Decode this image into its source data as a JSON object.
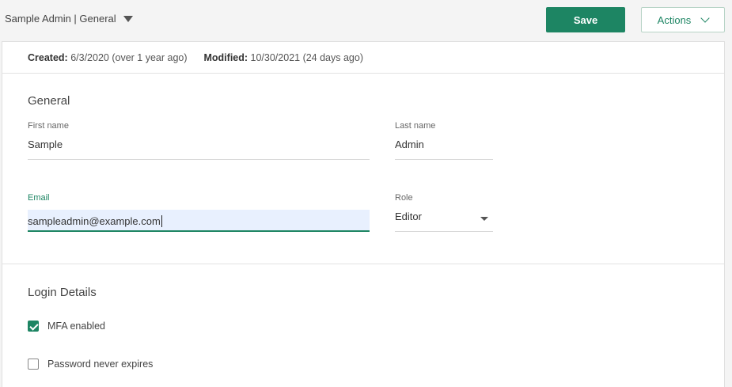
{
  "header": {
    "breadcrumb": "Sample Admin | General",
    "save_label": "Save",
    "actions_label": "Actions"
  },
  "meta": {
    "created_label": "Created:",
    "created_value": "6/3/2020 (over 1 year ago)",
    "modified_label": "Modified:",
    "modified_value": "10/30/2021 (24 days ago)"
  },
  "general": {
    "title": "General",
    "first_name": {
      "label": "First name",
      "value": "Sample"
    },
    "last_name": {
      "label": "Last name",
      "value": "Admin"
    },
    "email": {
      "label": "Email",
      "value": "sampleadmin@example.com"
    },
    "role": {
      "label": "Role",
      "value": "Editor"
    }
  },
  "login": {
    "title": "Login Details",
    "mfa": {
      "label": "MFA enabled",
      "checked": true
    },
    "password_never_expires": {
      "label": "Password never expires",
      "checked": false
    }
  },
  "colors": {
    "accent": "#1d8563",
    "focus_bg": "#e8f0fe"
  },
  "icons": {
    "breadcrumb_toggle": "caret-down-icon",
    "actions_toggle": "chevron-down-icon",
    "role_toggle": "caret-down-icon",
    "check": "check-icon"
  }
}
